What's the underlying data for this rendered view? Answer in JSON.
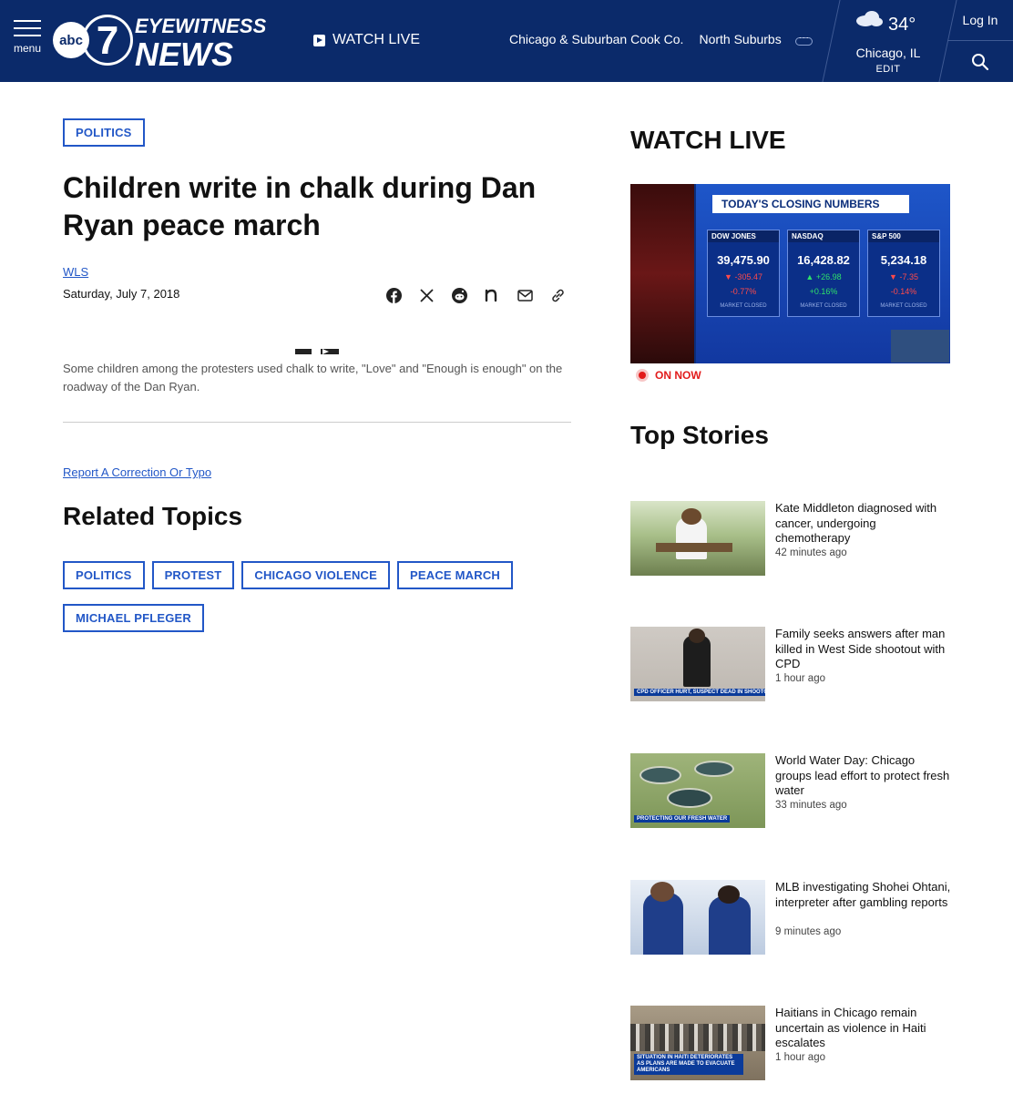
{
  "header": {
    "menu_label": "menu",
    "logo_abc": "abc",
    "logo_seven": "7",
    "logo_eyewitness": "EYEWITNESS",
    "logo_news": "NEWS",
    "watch_live": "WATCH LIVE",
    "nav": [
      "Chicago & Suburban Cook Co.",
      "North Suburbs"
    ],
    "weather": {
      "temp": "34°",
      "city": "Chicago, IL",
      "edit": "EDIT",
      "icon": "cloud-icon"
    },
    "login": "Log In"
  },
  "article": {
    "category": "POLITICS",
    "headline": "Children write in chalk during Dan Ryan peace march",
    "byline": "WLS",
    "date": "Saturday, July 7, 2018",
    "share_icons": [
      "facebook-icon",
      "x-icon",
      "reddit-icon",
      "nextdoor-icon",
      "email-icon",
      "link-icon"
    ],
    "caption": "Some children among the protesters used chalk to write, \"Love\" and \"Enough is enough\" on the roadway of the Dan Ryan.",
    "correction": "Report A Correction Or Typo",
    "related_title": "Related Topics",
    "related_tags": [
      "POLITICS",
      "PROTEST",
      "CHICAGO VIOLENCE",
      "PEACE MARCH",
      "MICHAEL PFLEGER"
    ]
  },
  "sidebar": {
    "watch_live_title": "WATCH LIVE",
    "video": {
      "banner": "TODAY'S CLOSING NUMBERS",
      "indices": [
        {
          "name": "DOW JONES",
          "value": "39,475.90",
          "change": "-305.47",
          "pct": "-0.77%",
          "dir": "down"
        },
        {
          "name": "NASDAQ",
          "value": "16,428.82",
          "change": "+26.98",
          "pct": "+0.16%",
          "dir": "up"
        },
        {
          "name": "S&P 500",
          "value": "5,234.18",
          "change": "-7.35",
          "pct": "-0.14%",
          "dir": "down"
        }
      ],
      "market_closed": "MARKET CLOSED"
    },
    "on_now": "ON NOW",
    "top_stories_title": "Top Stories",
    "stories": [
      {
        "title": "Kate Middleton diagnosed with cancer, undergoing chemotherapy",
        "time": "42 minutes ago"
      },
      {
        "title": "Family seeks answers after man killed in West Side shootout with CPD",
        "time": "1 hour ago",
        "chyron": "CPD OFFICER HURT, SUSPECT DEAD IN SHOOTOUT"
      },
      {
        "title": "World Water Day: Chicago groups lead effort to protect fresh water",
        "time": "33 minutes ago",
        "chyron": "PROTECTING OUR FRESH WATER"
      },
      {
        "title": "MLB investigating Shohei Ohtani, interpreter after gambling reports",
        "time": "9 minutes ago"
      },
      {
        "title": "Haitians in Chicago remain uncertain as violence in Haiti escalates",
        "time": "1 hour ago",
        "chyron": "SITUATION IN HAITI DETERIORATES AS PLANS ARE MADE TO EVACUATE AMERICANS"
      }
    ]
  },
  "colors": {
    "header_bg": "#0b2a6a",
    "link_blue": "#2257c7",
    "live_red": "#e21b1b"
  }
}
